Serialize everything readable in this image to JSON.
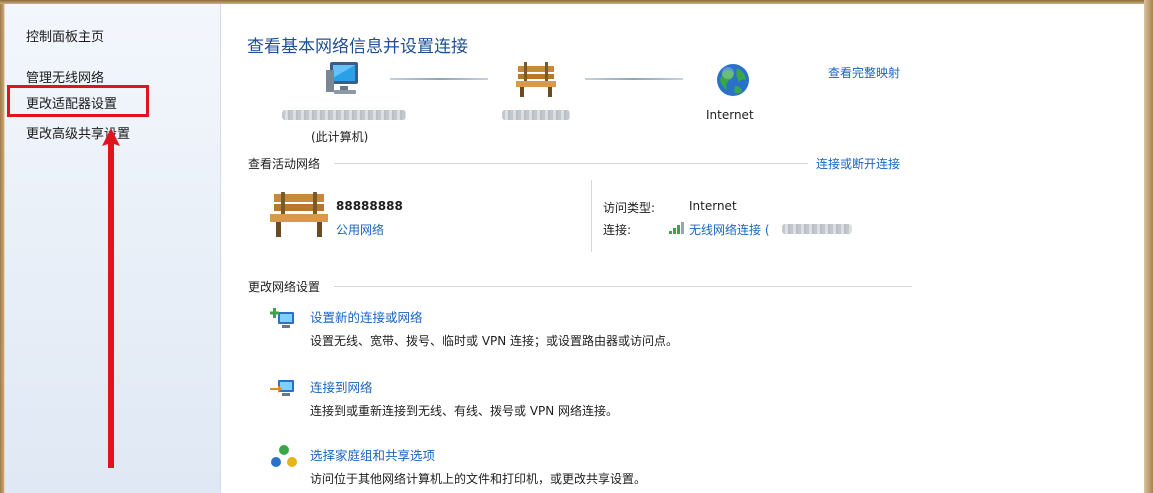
{
  "sidebar": {
    "items": [
      {
        "label": "控制面板主页"
      },
      {
        "label": "管理无线网络"
      },
      {
        "label": "更改适配器设置"
      },
      {
        "label": "更改高级共享设置"
      }
    ]
  },
  "main": {
    "title": "查看基本网络信息并设置连接",
    "map": {
      "view_full_map": "查看完整映射",
      "computer_sublabel": "(此计算机)",
      "internet_label": "Internet"
    },
    "active": {
      "header": "查看活动网络",
      "connect_disconnect": "连接或断开连接",
      "network_name": "88888888",
      "network_type": "公用网络",
      "access_type_label": "访问类型:",
      "access_type_value": "Internet",
      "connection_label": "连接:",
      "connection_value": "无线网络连接 ("
    },
    "change": {
      "header": "更改网络设置",
      "tasks": [
        {
          "title": "设置新的连接或网络",
          "desc": "设置无线、宽带、拨号、临时或 VPN 连接；或设置路由器或访问点。"
        },
        {
          "title": "连接到网络",
          "desc": "连接到或重新连接到无线、有线、拨号或 VPN 网络连接。"
        },
        {
          "title": "选择家庭组和共享选项",
          "desc": "访问位于其他网络计算机上的文件和打印机，或更改共享设置。"
        }
      ]
    }
  },
  "colors": {
    "title": "#1f4f92",
    "link": "#1a64c2",
    "highlight": "#e0141e"
  },
  "icons": [
    "computer-icon",
    "bench-icon",
    "globe-icon",
    "signal-icon",
    "new-connection-icon",
    "connect-network-icon",
    "homegroup-icon"
  ]
}
